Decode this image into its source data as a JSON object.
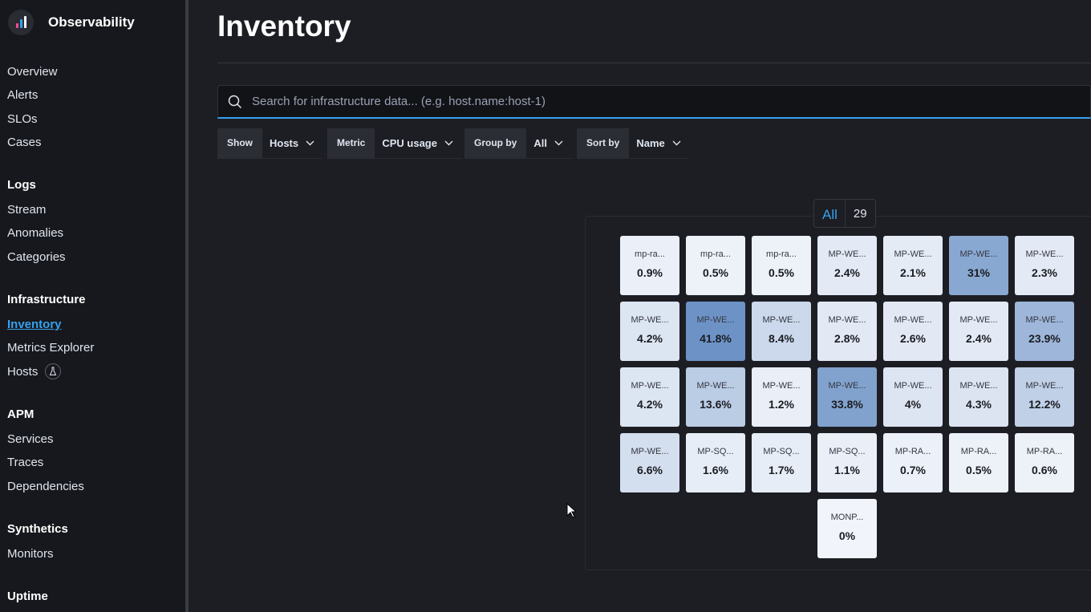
{
  "app": {
    "title": "Observability"
  },
  "colors": {
    "accent": "#36a2ef",
    "tile_low": "#f1f4fa",
    "tile_high": "#6d93c6"
  },
  "sidebar": {
    "top_items": [
      {
        "label": "Overview"
      },
      {
        "label": "Alerts"
      },
      {
        "label": "SLOs"
      },
      {
        "label": "Cases"
      }
    ],
    "logs": {
      "title": "Logs",
      "items": [
        {
          "label": "Stream"
        },
        {
          "label": "Anomalies"
        },
        {
          "label": "Categories"
        }
      ]
    },
    "infrastructure": {
      "title": "Infrastructure",
      "items": [
        {
          "label": "Inventory"
        },
        {
          "label": "Metrics Explorer"
        },
        {
          "label": "Hosts"
        }
      ]
    },
    "apm": {
      "title": "APM",
      "items": [
        {
          "label": "Services"
        },
        {
          "label": "Traces"
        },
        {
          "label": "Dependencies"
        }
      ]
    },
    "synthetics": {
      "title": "Synthetics",
      "items": [
        {
          "label": "Monitors"
        }
      ]
    },
    "uptime": {
      "title": "Uptime"
    }
  },
  "page": {
    "title": "Inventory"
  },
  "search": {
    "placeholder": "Search for infrastructure data... (e.g. host.name:host-1)"
  },
  "filters": {
    "show": {
      "label": "Show",
      "value": "Hosts"
    },
    "metric": {
      "label": "Metric",
      "value": "CPU usage"
    },
    "group_by": {
      "label": "Group by",
      "value": "All"
    },
    "sort_by": {
      "label": "Sort by",
      "value": "Name"
    }
  },
  "group": {
    "name": "All",
    "count": "29"
  },
  "tiles": [
    {
      "name": "mp-ra...",
      "value": "0.9%",
      "pct": 0.9
    },
    {
      "name": "mp-ra...",
      "value": "0.5%",
      "pct": 0.5
    },
    {
      "name": "mp-ra...",
      "value": "0.5%",
      "pct": 0.5
    },
    {
      "name": "MP-WE...",
      "value": "2.4%",
      "pct": 2.4
    },
    {
      "name": "MP-WE...",
      "value": "2.1%",
      "pct": 2.1
    },
    {
      "name": "MP-WE...",
      "value": "31%",
      "pct": 31
    },
    {
      "name": "MP-WE...",
      "value": "2.3%",
      "pct": 2.3
    },
    {
      "name": "MP-WE...",
      "value": "4.2%",
      "pct": 4.2
    },
    {
      "name": "MP-WE...",
      "value": "41.8%",
      "pct": 41.8
    },
    {
      "name": "MP-WE...",
      "value": "8.4%",
      "pct": 8.4
    },
    {
      "name": "MP-WE...",
      "value": "2.8%",
      "pct": 2.8
    },
    {
      "name": "MP-WE...",
      "value": "2.6%",
      "pct": 2.6
    },
    {
      "name": "MP-WE...",
      "value": "2.4%",
      "pct": 2.4
    },
    {
      "name": "MP-WE...",
      "value": "23.9%",
      "pct": 23.9
    },
    {
      "name": "MP-WE...",
      "value": "4.2%",
      "pct": 4.2
    },
    {
      "name": "MP-WE...",
      "value": "13.6%",
      "pct": 13.6
    },
    {
      "name": "MP-WE...",
      "value": "1.2%",
      "pct": 1.2
    },
    {
      "name": "MP-WE...",
      "value": "33.8%",
      "pct": 33.8
    },
    {
      "name": "MP-WE...",
      "value": "4%",
      "pct": 4
    },
    {
      "name": "MP-WE...",
      "value": "4.3%",
      "pct": 4.3
    },
    {
      "name": "MP-WE...",
      "value": "12.2%",
      "pct": 12.2
    },
    {
      "name": "MP-WE...",
      "value": "6.6%",
      "pct": 6.6
    },
    {
      "name": "MP-SQ...",
      "value": "1.6%",
      "pct": 1.6
    },
    {
      "name": "MP-SQ...",
      "value": "1.7%",
      "pct": 1.7
    },
    {
      "name": "MP-SQ...",
      "value": "1.1%",
      "pct": 1.1
    },
    {
      "name": "MP-RA...",
      "value": "0.7%",
      "pct": 0.7
    },
    {
      "name": "MP-RA...",
      "value": "0.5%",
      "pct": 0.5
    },
    {
      "name": "MP-RA...",
      "value": "0.6%",
      "pct": 0.6
    },
    {
      "name": "MONP...",
      "value": "0%",
      "pct": 0
    }
  ]
}
